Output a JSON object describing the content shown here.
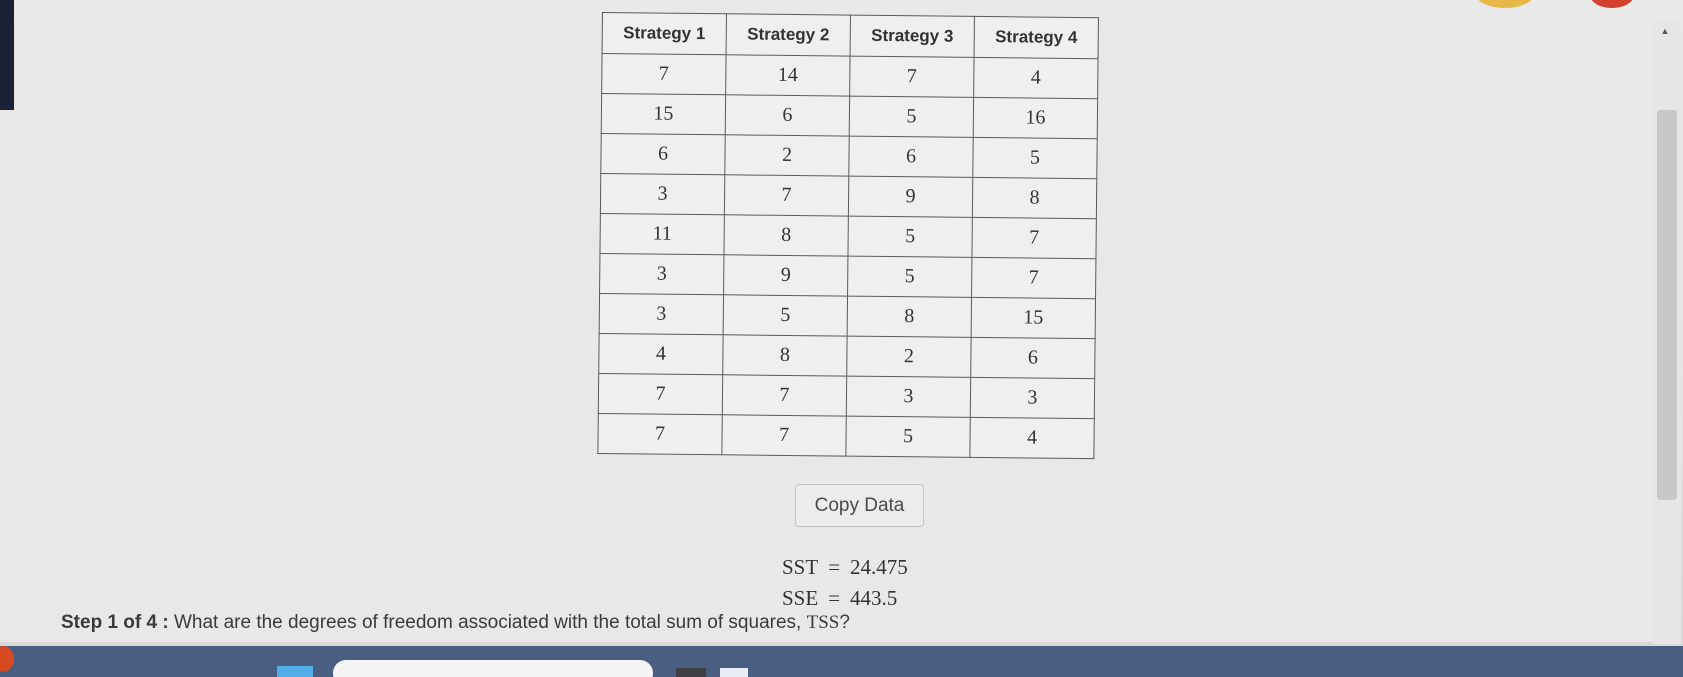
{
  "table": {
    "headers": [
      "Strategy 1",
      "Strategy 2",
      "Strategy 3",
      "Strategy 4"
    ],
    "rows": [
      [
        "7",
        "14",
        "7",
        "4"
      ],
      [
        "15",
        "6",
        "5",
        "16"
      ],
      [
        "6",
        "2",
        "6",
        "5"
      ],
      [
        "3",
        "7",
        "9",
        "8"
      ],
      [
        "11",
        "8",
        "5",
        "7"
      ],
      [
        "3",
        "9",
        "5",
        "7"
      ],
      [
        "3",
        "5",
        "8",
        "15"
      ],
      [
        "4",
        "8",
        "2",
        "6"
      ],
      [
        "7",
        "7",
        "3",
        "3"
      ],
      [
        "7",
        "7",
        "5",
        "4"
      ]
    ]
  },
  "copy_button": {
    "label": "Copy Data"
  },
  "stats": {
    "sst_label": "SST",
    "sst_eq": "=",
    "sst_value": "24.475",
    "sse_label": "SSE",
    "sse_eq": "=",
    "sse_value": "443.5"
  },
  "question": {
    "step_label": "Step 1 of 4 :",
    "text": "What are the degrees of freedom associated with the total sum of squares,",
    "tss": "TSS",
    "end": "?"
  },
  "icons": {
    "scroll_up": "scroll-up-arrow-icon",
    "start": "windows-start-icon",
    "search": "taskbar-search-box",
    "task_view": "task-view-icon"
  },
  "colors": {
    "taskbar": "#4a5e82",
    "start_icon": "#53aee8",
    "table_border": "#5a5a5a"
  }
}
